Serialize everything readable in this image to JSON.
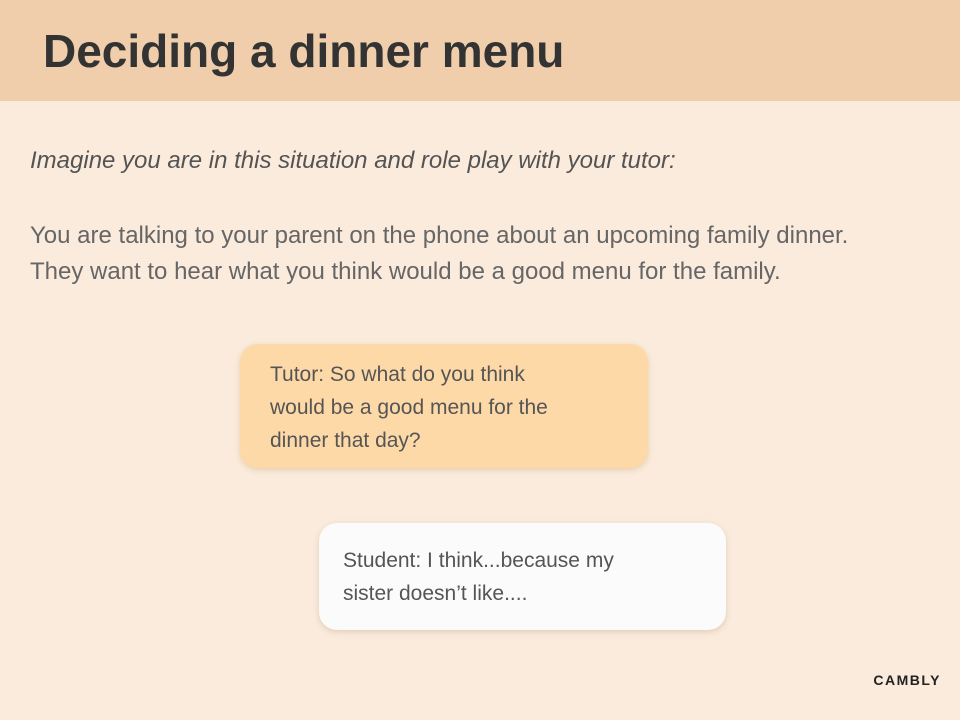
{
  "slide": {
    "title": "Deciding a dinner menu",
    "instruction": "Imagine you are in this situation and role play with your tutor:",
    "scenario_lines": [
      "You are talking to your parent on the phone about an upcoming family dinner.",
      "They want to hear what you think would be a good menu for the family."
    ]
  },
  "dialogue": {
    "tutor_lines": [
      "Tutor: So what do you think",
      "would be a good menu for the",
      "dinner that day?"
    ],
    "student_lines": [
      "Student: I think...because my",
      "sister doesn’t like...."
    ]
  },
  "brand": {
    "logo_text": "CAMBLY"
  },
  "colors": {
    "background": "#faebdc",
    "header": "#f0ceac",
    "tutor_bubble": "#fed9a8",
    "student_bubble": "#fbfbfb"
  }
}
